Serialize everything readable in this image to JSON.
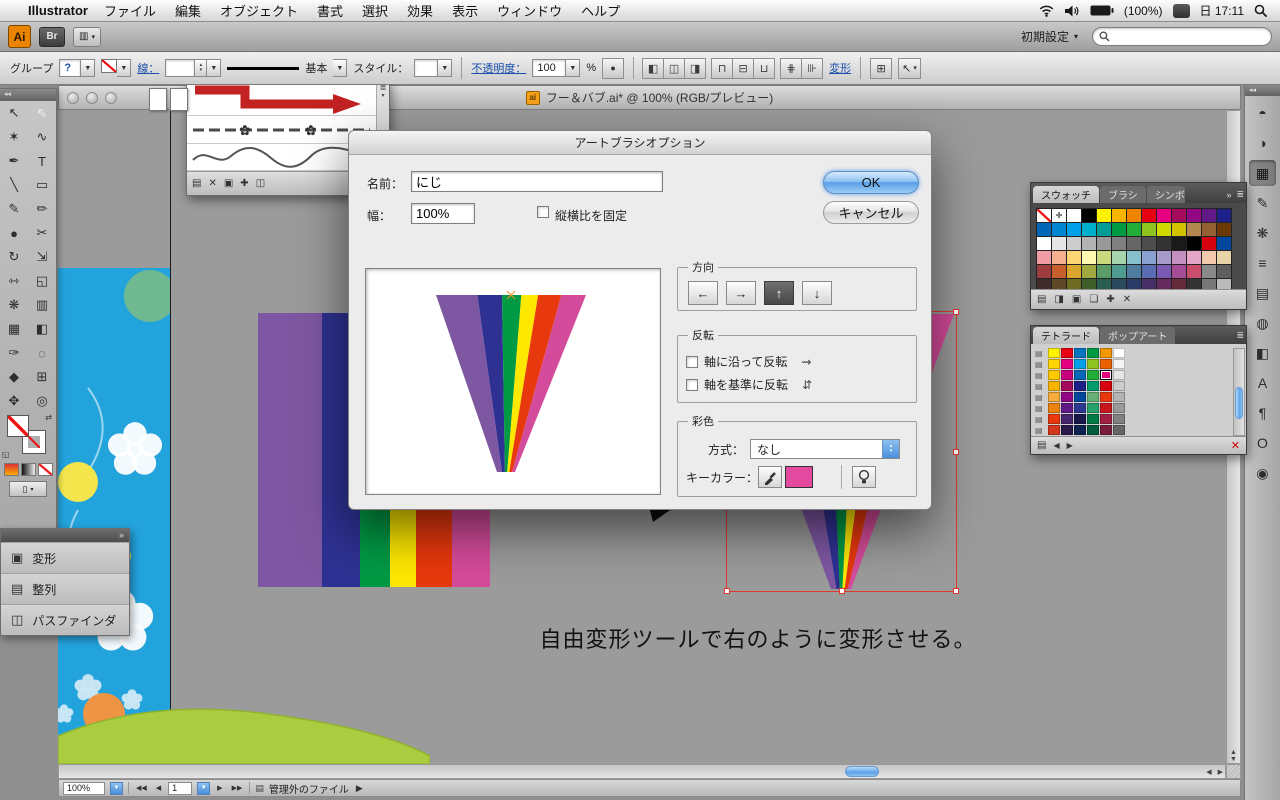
{
  "icons": {
    "dd": "▼",
    "dd_small": "▾",
    "stepper_up": "▴",
    "stepper_down": "▾",
    "chevrons_left": "◂◂",
    "chevrons_right": "»",
    "panel_menu": "≣",
    "swap": "⇄",
    "page": "▤",
    "apple": ""
  },
  "menubar": {
    "app_name": "Illustrator",
    "items": [
      "ファイル",
      "編集",
      "オブジェクト",
      "書式",
      "選択",
      "効果",
      "表示",
      "ウィンドウ",
      "ヘルプ"
    ],
    "battery_label": "(100%)",
    "clock": "日 17:11"
  },
  "app_bar": {
    "ai_logo": "Ai",
    "bridge_label": "Br",
    "arrange_glyph": "▥",
    "preset_label": "初期設定"
  },
  "control_bar": {
    "selection_label": "グループ",
    "help_glyph": "?",
    "stroke_link": "線：",
    "brush_basic_label": "基本",
    "style_label": "スタイル：",
    "opacity_link": "不透明度：",
    "opacity_value": "100",
    "percent_label": "%",
    "mask_glyph": "●",
    "transform_link": "変形",
    "align_buttons": [
      {
        "name": "align-left-button",
        "glyph": "◧"
      },
      {
        "name": "align-center-button",
        "glyph": "◫"
      },
      {
        "name": "align-right-button",
        "glyph": "◨"
      },
      {
        "name": "align-top-button",
        "glyph": "⊓"
      },
      {
        "name": "align-middle-button",
        "glyph": "⊟"
      },
      {
        "name": "align-bottom-button",
        "glyph": "⊔"
      },
      {
        "name": "distribute-horizontal-button",
        "glyph": "⋕"
      },
      {
        "name": "distribute-vertical-button",
        "glyph": "⊪"
      }
    ],
    "isolate_glyph": "⊞",
    "select-similar_glyph": "↖"
  },
  "doc_window": {
    "title": "フー＆バブ.ai* @ 100% (RGB/プレビュー)",
    "file_icon_label": "ai"
  },
  "toolbar": {
    "tools": [
      {
        "name": "selection-tool",
        "glyph": "↖"
      },
      {
        "name": "direct-selection-tool",
        "glyph": "⇖"
      },
      {
        "name": "magic-wand-tool",
        "glyph": "✶"
      },
      {
        "name": "lasso-tool",
        "glyph": "∿"
      },
      {
        "name": "pen-tool",
        "glyph": "✒"
      },
      {
        "name": "type-tool",
        "glyph": "T"
      },
      {
        "name": "line-tool",
        "glyph": "╲"
      },
      {
        "name": "rectangle-tool",
        "glyph": "▭"
      },
      {
        "name": "paintbrush-tool",
        "glyph": "✎"
      },
      {
        "name": "pencil-tool",
        "glyph": "✏"
      },
      {
        "name": "blob-brush-tool",
        "glyph": "●"
      },
      {
        "name": "eraser-tool",
        "glyph": "✂"
      },
      {
        "name": "rotate-tool",
        "glyph": "↻"
      },
      {
        "name": "scale-tool",
        "glyph": "⇲"
      },
      {
        "name": "width-tool",
        "glyph": "⇿"
      },
      {
        "name": "free-transform-tool",
        "glyph": "◱"
      },
      {
        "name": "symbol-sprayer-tool",
        "glyph": "❋"
      },
      {
        "name": "graph-tool",
        "glyph": "▥"
      },
      {
        "name": "mesh-tool",
        "glyph": "▦"
      },
      {
        "name": "gradient-tool",
        "glyph": "◧"
      },
      {
        "name": "eyedropper-tool",
        "glyph": "✑"
      },
      {
        "name": "blend-tool",
        "glyph": "◌"
      },
      {
        "name": "live-paint-bucket-tool",
        "glyph": "◆"
      },
      {
        "name": "artboard-tool",
        "glyph": "⊞"
      },
      {
        "name": "hand-tool",
        "glyph": "✥"
      },
      {
        "name": "zoom-tool",
        "glyph": "◎"
      }
    ]
  },
  "dialog": {
    "title": "アートブラシオプション",
    "name_label": "名前：",
    "name_value": "にじ",
    "width_label": "幅：",
    "width_value": "100%",
    "fix_ratio_label": "縦横比を固定",
    "ok_label": "OK",
    "cancel_label": "キャンセル",
    "direction_label": "方向",
    "direction_arrows": [
      "←",
      "→",
      "↑",
      "↓"
    ],
    "direction_selected": 2,
    "flip_label": "反転",
    "flip_along_label": "軸に沿って反転",
    "flip_along_icon": "⇝",
    "flip_across_label": "軸を基準に反転",
    "flip_across_icon": "⇵",
    "colorize_label": "彩色",
    "method_label": "方式：",
    "method_value": "なし",
    "key_color_label": "キーカラー：",
    "key_color": "#e2499f"
  },
  "fan": {
    "colors": [
      "#7e57a2",
      "#2e3192",
      "#009944",
      "#ffe800",
      "#e8380d",
      "#d54b9b"
    ],
    "fractions": [
      0.276,
      0.164,
      0.129,
      0.112,
      0.155,
      0.164
    ]
  },
  "canvas": {
    "caption": "自由変形ツールで右のように変形させる。"
  },
  "brush_popup": {
    "footer_icons": [
      {
        "name": "brush-libraries-icon",
        "glyph": "▤"
      },
      {
        "name": "remove-brush-stroke-icon",
        "glyph": "✕"
      },
      {
        "name": "brush-options-icon",
        "glyph": "▣"
      },
      {
        "name": "new-brush-icon",
        "glyph": "✚"
      },
      {
        "name": "delete-brush-icon",
        "glyph": "◫"
      }
    ]
  },
  "swatches_panel": {
    "tabs": [
      "スウォッチ",
      "ブラシ",
      "シンボ"
    ],
    "rows": [
      [
        "none",
        "reg",
        "#ffffff",
        "#000000",
        "#fff100",
        "#f8b500",
        "#f08300",
        "#e60012",
        "#e4007f",
        "#a40b5d",
        "#920783",
        "#601986",
        "#1d2088"
      ],
      [
        "#0068b7",
        "#0086d1",
        "#00a0e9",
        "#00afcc",
        "#009e96",
        "#009944",
        "#22ac38",
        "#8fc31f",
        "#cfdb00",
        "#d3c200",
        "#b28850",
        "#956134",
        "#6a3906"
      ],
      [
        "#ffffff",
        "#e6e6e6",
        "#cccccc",
        "#b3b3b3",
        "#999999",
        "#808080",
        "#666666",
        "#4d4d4d",
        "#333333",
        "#1a1a1a",
        "#000000",
        "#d7000f",
        "#00479d"
      ],
      [
        "#f19ca7",
        "#f5b090",
        "#fcd575",
        "#fff9b1",
        "#c8d97e",
        "#a5d4ad",
        "#87c0cd",
        "#89a1d0",
        "#a59aca",
        "#c490bf",
        "#e4a6c7",
        "#f2c9ac",
        "#e8d3a9"
      ],
      [
        "#9e3d3f",
        "#c7602d",
        "#d9a62e",
        "#9fa93f",
        "#5b9b68",
        "#4f9b8f",
        "#4f7da1",
        "#5a6cb2",
        "#7a5ab2",
        "#a54c97",
        "#c94e6b",
        "#8a8a8a",
        "#5e5e5e"
      ],
      [
        "#3e2b2b",
        "#5c4827",
        "#6e6b23",
        "#3f5e2a",
        "#2a5e50",
        "#2a4a5e",
        "#2b3a66",
        "#473066",
        "#662b5e",
        "#662b3a",
        "#333333",
        "#777777",
        "#bbbbbb"
      ]
    ],
    "footer_icons": [
      {
        "name": "swatch-libraries-icon",
        "glyph": "▤"
      },
      {
        "name": "swatch-kinds-icon",
        "glyph": "◨"
      },
      {
        "name": "swatch-options-icon",
        "glyph": "▣"
      },
      {
        "name": "new-swatch-group-icon",
        "glyph": "❏"
      },
      {
        "name": "new-swatch-icon",
        "glyph": "✚"
      },
      {
        "name": "delete-swatch-icon",
        "glyph": "✕"
      }
    ]
  },
  "tetrad_panel": {
    "tabs": [
      "テトラード",
      "ポップアート"
    ],
    "selected": [
      2,
      4
    ],
    "groups": [
      {
        "colors": [
          "#fff100",
          "#e60012",
          "#0075c2",
          "#009944",
          "#f39800",
          "#ffffff"
        ]
      },
      {
        "colors": [
          "#ffd400",
          "#e4007f",
          "#00a0e9",
          "#8fc31f",
          "#eb6100",
          "#f5f5f5"
        ]
      },
      {
        "colors": [
          "#fcc800",
          "#c7007d",
          "#0068b7",
          "#22ac38",
          "#e4007f",
          "#e6e6e6"
        ]
      },
      {
        "colors": [
          "#f8b500",
          "#a40b5d",
          "#1d2088",
          "#009b6b",
          "#d7000f",
          "#cccccc"
        ]
      },
      {
        "colors": [
          "#f6ad3c",
          "#920783",
          "#00479d",
          "#69b076",
          "#e8380d",
          "#b3b3b3"
        ]
      },
      {
        "colors": [
          "#ef810f",
          "#601986",
          "#2b3990",
          "#28a16c",
          "#c9161d",
          "#999999"
        ]
      },
      {
        "colors": [
          "#e8380d",
          "#47266e",
          "#17184b",
          "#007b43",
          "#a22041",
          "#808080"
        ]
      },
      {
        "colors": [
          "#d3381c",
          "#2a1a4a",
          "#0f2350",
          "#005c3c",
          "#7b1e3c",
          "#666666"
        ]
      }
    ],
    "footer": {
      "left_arrow": "◀",
      "right_arrow": "▶",
      "close_glyph": "✕"
    }
  },
  "dock": {
    "icons": [
      {
        "name": "color-panel-icon",
        "glyph": "◓"
      },
      {
        "name": "color-guide-panel-icon",
        "glyph": "◑"
      },
      {
        "name": "swatches-panel-icon",
        "glyph": "▦",
        "active": true
      },
      {
        "name": "brushes-panel-icon",
        "glyph": "✎"
      },
      {
        "name": "symbols-panel-icon",
        "glyph": "❋"
      },
      {
        "name": "stroke-panel-icon",
        "glyph": "≡"
      },
      {
        "name": "layers-panel-icon",
        "glyph": "▤"
      },
      {
        "name": "transparency-panel-icon",
        "glyph": "◍"
      },
      {
        "name": "gradient-panel-icon",
        "glyph": "◧"
      },
      {
        "name": "character-panel-icon",
        "glyph": "A"
      },
      {
        "name": "paragraph-panel-icon",
        "glyph": "¶"
      },
      {
        "name": "opentype-panel-icon",
        "glyph": "O"
      },
      {
        "name": "appearance-panel-icon",
        "glyph": "◉"
      }
    ]
  },
  "floating_panel": {
    "items": [
      {
        "name": "transform-panel-item",
        "glyph": "▣",
        "label": "変形"
      },
      {
        "name": "align-panel-item",
        "glyph": "▤",
        "label": "整列"
      },
      {
        "name": "pathfinder-panel-item",
        "glyph": "◫",
        "label": "パスファインダ"
      }
    ]
  },
  "statusbar": {
    "zoom_value": "100%",
    "first_glyph": "◀◀",
    "prev_glyph": "◀",
    "page_value": "1",
    "next_glyph": "▶",
    "last_glyph": "▶▶",
    "status_text": "管理外のファイル",
    "expand_glyph": "▶"
  }
}
